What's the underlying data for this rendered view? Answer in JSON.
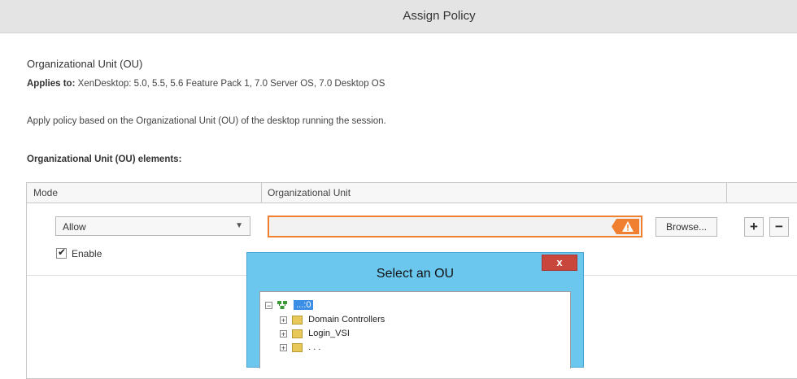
{
  "window": {
    "title": "Assign Policy"
  },
  "setting": {
    "name": "Organizational Unit (OU)",
    "applies_label": "Applies to:",
    "applies_value": "XenDesktop: 5.0, 5.5, 5.6 Feature Pack 1, 7.0 Server OS, 7.0 Desktop OS",
    "description": "Apply policy based on the Organizational Unit (OU) of the desktop running the session.",
    "elements_label": "Organizational Unit (OU) elements:"
  },
  "grid": {
    "columns": [
      "Mode",
      "Organizational Unit"
    ],
    "row": {
      "mode_value": "Allow",
      "enable_label": "Enable",
      "enable_checked": true,
      "ou_value": "",
      "browse_label": "Browse...",
      "add_label": "+",
      "remove_label": "−"
    }
  },
  "dialog": {
    "title": "Select an OU",
    "close_label": "x",
    "tree": {
      "root_label": "...:0",
      "children": [
        "Domain Controllers",
        "Login_VSI",
        ". . ."
      ]
    }
  },
  "colors": {
    "accent_warning": "#f08030",
    "dialog_frame": "#6cc7ef",
    "selection": "#3a8ee6",
    "close_button": "#c9463d"
  },
  "icons": [
    "warning-icon",
    "chevron-down-icon",
    "check-icon",
    "plus-icon",
    "minus-icon",
    "close-icon",
    "domain-icon",
    "folder-icon",
    "expand-icon",
    "collapse-icon"
  ]
}
